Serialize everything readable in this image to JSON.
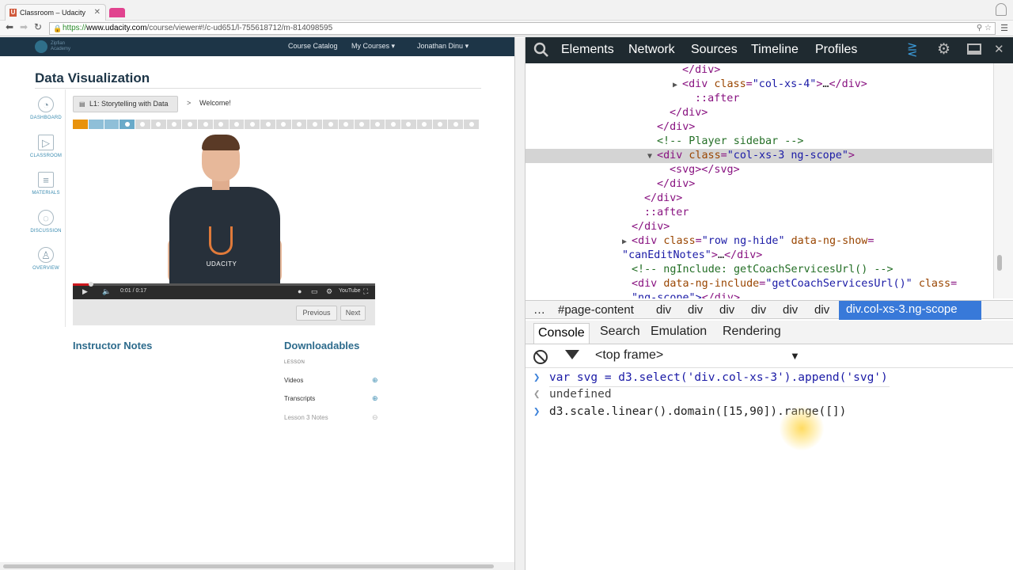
{
  "browser": {
    "tab_title": "Classroom – Udacity",
    "tab_favicon": "U",
    "url_scheme": "https://",
    "url_host": "www.udacity.com",
    "url_path": "/course/viewer#!/c-ud651/l-755618712/m-814098595"
  },
  "site": {
    "logo_text": "Zipfian Academy",
    "nav": {
      "course_catalog": "Course Catalog",
      "my_courses": "My Courses",
      "user": "Jonathan Dinu"
    },
    "page_title": "Data Visualization",
    "sidebar": [
      {
        "label": "DASHBOARD",
        "icon": "gauge-icon",
        "glyph": "◔"
      },
      {
        "label": "CLASSROOM",
        "icon": "play-icon",
        "glyph": "▷"
      },
      {
        "label": "MATERIALS",
        "icon": "document-icon",
        "glyph": "≡"
      },
      {
        "label": "DISCUSSION",
        "icon": "chat-icon",
        "glyph": "◌"
      },
      {
        "label": "OVERVIEW",
        "icon": "person-icon",
        "glyph": "♙"
      }
    ],
    "breadcrumb": {
      "lesson": "L1: Storytelling with Data",
      "separator": ">",
      "current": "Welcome!"
    },
    "video": {
      "shirt_logo": "U",
      "shirt_text": "UDACITY",
      "time": "0:01 / 0:17",
      "played_fraction": 0.06
    },
    "nav_buttons": {
      "previous": "Previous",
      "next": "Next"
    },
    "instructor_notes_title": "Instructor Notes",
    "downloadables": {
      "title": "Downloadables",
      "section": "LESSON",
      "items": [
        {
          "label": "Videos",
          "available": true
        },
        {
          "label": "Transcripts",
          "available": true
        },
        {
          "label": "Lesson 3 Notes",
          "available": false
        }
      ]
    }
  },
  "devtools": {
    "tabs": [
      "Elements",
      "Network",
      "Sources",
      "Timeline",
      "Profiles"
    ],
    "elements": {
      "closing_div": "</div>",
      "col4_tag": "div",
      "col4_attr": "class",
      "col4_val": "\"col-xs-4\"",
      "ellipsis": "…",
      "after": "::after",
      "comment_player": "<!-- Player sidebar -->",
      "sel_attr_val": "\"col-xs-3 ng-scope\"",
      "svg_line": "<svg></svg>",
      "row_val": "\"row ng-hide\"",
      "row_attr2": "data-ng-show",
      "row_val2": "\"",
      "row_cont": "canEditNotes\">…</div>",
      "comment_include": "<!-- ngInclude: getCoachServicesUrl() -->",
      "include_attr": "data-ng-include",
      "include_val": "\"getCoachServicesUrl()\"",
      "include_attr2": "class",
      "include_val2": "\"ng-scope\">",
      "include_tail": "</div>"
    },
    "breadcrumbs": [
      "…",
      "#page-content",
      "div",
      "div",
      "div",
      "div",
      "div",
      "div"
    ],
    "breadcrumb_active": "div.col-xs-3.ng-scope",
    "drawer_tabs": [
      "Console",
      "Search",
      "Emulation",
      "Rendering"
    ],
    "frame": "<top frame>",
    "console": [
      {
        "kind": "input",
        "text": "var svg = d3.select('div.col-xs-3').append('svg')"
      },
      {
        "kind": "result",
        "text": "undefined"
      },
      {
        "kind": "editing",
        "text": "d3.scale.linear().domain([15,90]).range([])"
      }
    ]
  }
}
